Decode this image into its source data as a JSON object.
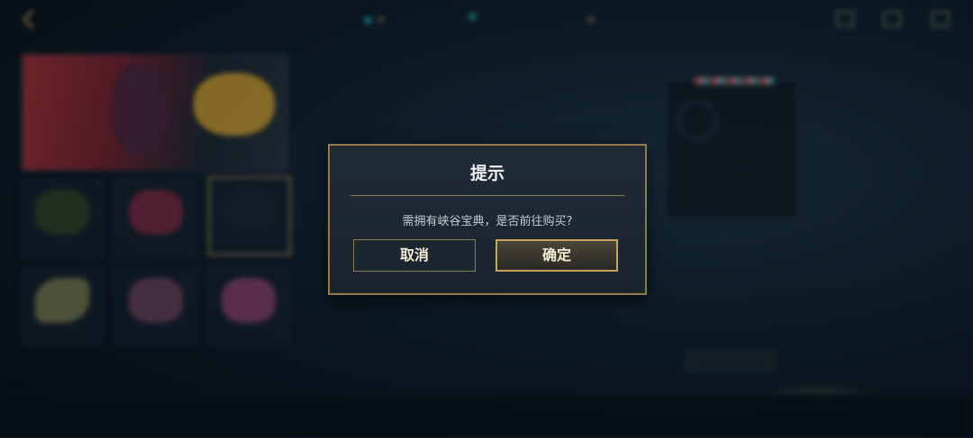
{
  "dialog": {
    "title": "提示",
    "message": "需拥有峡谷宝典，是否前往购买?",
    "cancel_label": "取消",
    "confirm_label": "确定"
  },
  "colors": {
    "accent_gold": "#c8a45e",
    "dialog_bg": "#1f2b37",
    "currency_teal": "#1fa9b8"
  },
  "icons": {
    "back": "chevron-left-icon",
    "currency": "coin-icon",
    "add": "plus-icon"
  }
}
